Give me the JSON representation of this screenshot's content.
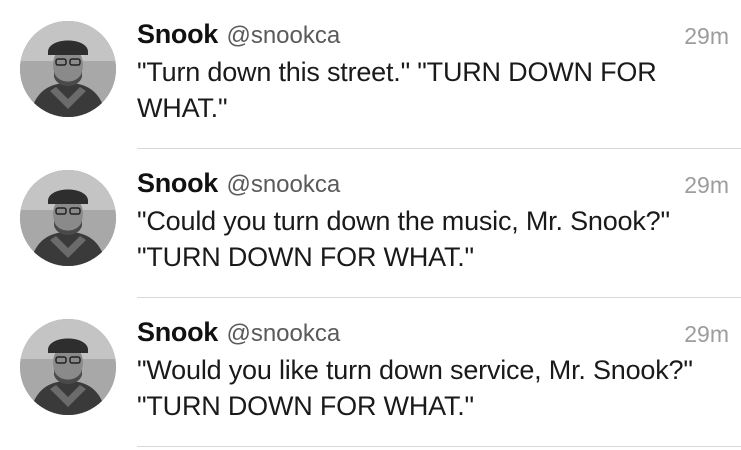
{
  "tweets": [
    {
      "name": "Snook",
      "handle": "@snookca",
      "time": "29m",
      "text": "\"Turn down this street.\" \"TURN DOWN FOR WHAT.\"",
      "avatar_icon": "user-avatar-photo"
    },
    {
      "name": "Snook",
      "handle": "@snookca",
      "time": "29m",
      "text": "\"Could you turn down the music, Mr. Snook?\" \"TURN DOWN FOR WHAT.\"",
      "avatar_icon": "user-avatar-photo"
    },
    {
      "name": "Snook",
      "handle": "@snookca",
      "time": "29m",
      "text": "\"Would you like turn down service, Mr. Snook?\" \"TURN DOWN FOR WHAT.\"",
      "avatar_icon": "user-avatar-photo"
    }
  ]
}
